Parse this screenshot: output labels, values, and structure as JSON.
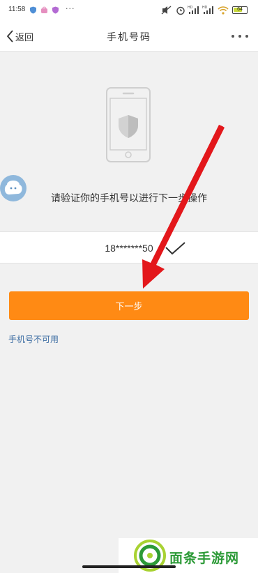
{
  "status_bar": {
    "time": "11:58",
    "more_dots": "···",
    "icons": [
      "shield-app-icon",
      "bag-app-icon",
      "heart-app-icon",
      "mute-icon",
      "alarm-icon",
      "signal-hd-icon",
      "signal-hd-icon",
      "wifi-icon",
      "battery-icon"
    ],
    "battery_level": "64"
  },
  "nav": {
    "back_label": "返回",
    "title": "手机号码",
    "icons": [
      "chevron-left-icon",
      "more-icon"
    ]
  },
  "illustration": {
    "icon": "phone-shield-icon"
  },
  "verify": {
    "prompt": "请验证你的手机号以进行下一步操作",
    "phone_number": "18*******50",
    "check_icon": "check-icon"
  },
  "next_button": {
    "label": "下一步"
  },
  "unavailable_link": {
    "label": "手机号不可用"
  },
  "watermark": {
    "text": "面条手游网"
  },
  "colors": {
    "accent": "#ff8a14",
    "link": "#3f6fa4",
    "annotation_arrow": "#e3171b",
    "background": "#f1f1f1",
    "watermark": "#2c9a37"
  }
}
